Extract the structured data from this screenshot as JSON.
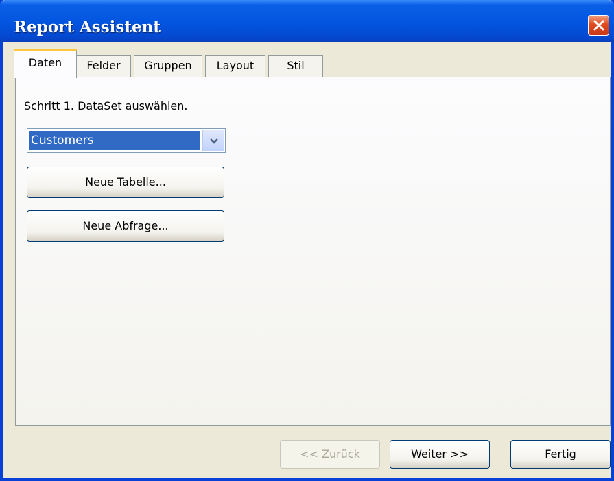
{
  "window": {
    "title": "Report Assistent"
  },
  "tabs": [
    "Daten",
    "Felder",
    "Gruppen",
    "Layout",
    "Stil"
  ],
  "active_tab": "Daten",
  "daten": {
    "step_label": "Schritt 1. DataSet auswählen.",
    "dataset_select": {
      "value": "Customers"
    },
    "new_table_label": "Neue Tabelle...",
    "new_query_label": "Neue Abfrage..."
  },
  "footer": {
    "back_label": "<< Zurück",
    "next_label": "Weiter >>",
    "finish_label": "Fertig"
  },
  "colors": {
    "titlebar": "#0256e0",
    "active_tab_highlight": "#ffc83c",
    "selection": "#316ac5"
  }
}
